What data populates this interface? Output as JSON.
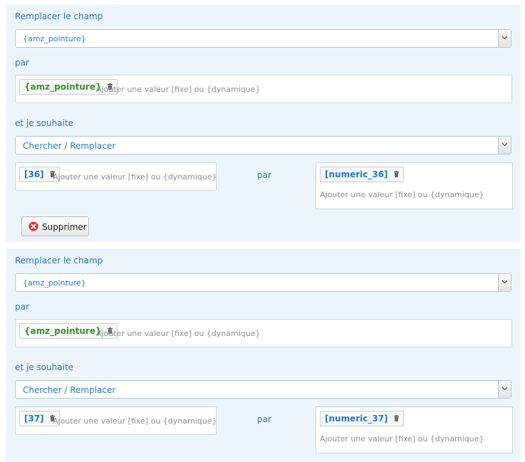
{
  "blocks": [
    {
      "label_replace": "Remplacer le champ",
      "field_select": "{amz_pointure}",
      "label_par": "par",
      "value_chip": "{amz_pointure}",
      "value_placeholder": "Ajouter une valeur [fixe] ou {dynamique}",
      "label_wish": "et je souhaite",
      "action_select": "Chercher / Remplacer",
      "search_chip": "[36]",
      "search_placeholder": "Ajouter une valeur [fixe] ou {dynamique}",
      "label_par_mid": "par",
      "replace_chip": "[numeric_36]",
      "replace_placeholder": "Ajouter une valeur [fixe] ou {dynamique}",
      "delete_label": "Supprimer"
    },
    {
      "label_replace": "Remplacer le champ",
      "field_select": "{amz_pointure}",
      "label_par": "par",
      "value_chip": "{amz_pointure}",
      "value_placeholder": "Ajouter une valeur [fixe] ou {dynamique}",
      "label_wish": "et je souhaite",
      "action_select": "Chercher / Remplacer",
      "search_chip": "[37]",
      "search_placeholder": "Ajouter une valeur [fixe] ou {dynamique}",
      "label_par_mid": "par",
      "replace_chip": "[numeric_37]",
      "replace_placeholder": "Ajouter une valeur [fixe] ou {dynamique}"
    }
  ],
  "icons": {
    "trash": "trash-icon",
    "dropdown": "chevron-down-icon",
    "delete": "close-circle-icon"
  },
  "colors": {
    "label_blue": "#2a78c2",
    "chip_green": "#3e8f2a",
    "delete_red": "#d9342b",
    "block_bg": "#edf5fb"
  }
}
